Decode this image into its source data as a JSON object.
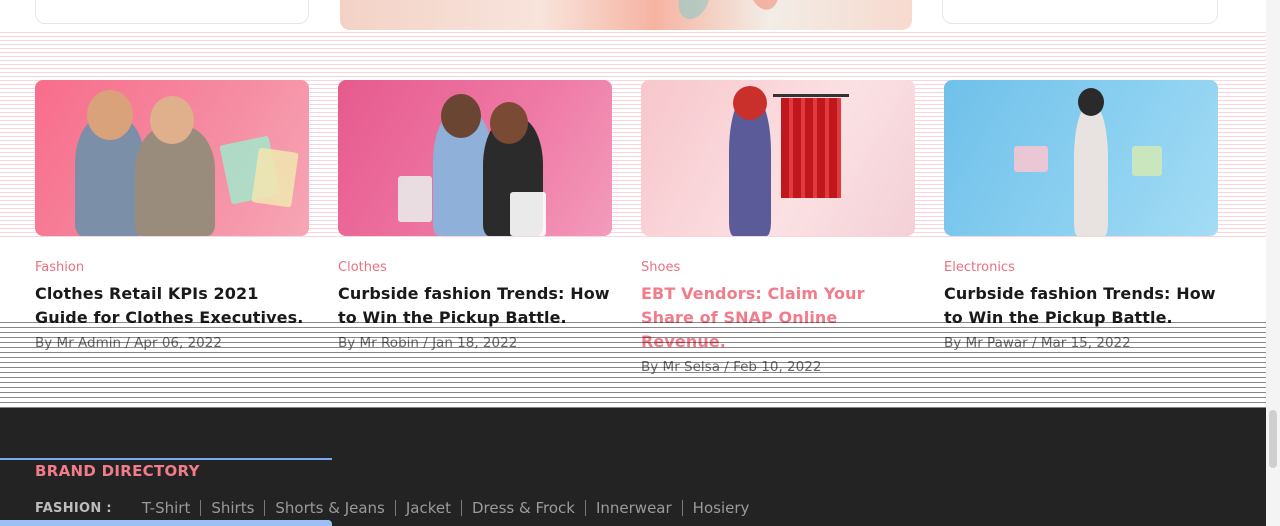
{
  "posts": [
    {
      "category": "Fashion",
      "title": "Clothes Retail KPIs 2021 Guide for Clothes Executives.",
      "meta": "By Mr Admin / Apr 06, 2022"
    },
    {
      "category": "Clothes",
      "title": "Curbside fashion Trends: How to Win the Pickup Battle.",
      "meta": "By Mr Robin / Jan 18, 2022"
    },
    {
      "category": "Shoes",
      "title": "EBT Vendors: Claim Your Share of SNAP Online Revenue.",
      "meta": "By Mr Selsa / Feb 10, 2022"
    },
    {
      "category": "Electronics",
      "title": "Curbside fashion Trends: How to Win the Pickup Battle.",
      "meta": "By Mr Pawar / Mar 15, 2022"
    }
  ],
  "footer": {
    "brand_directory": "BRAND DIRECTORY",
    "fashion_label": "FASHION :",
    "fashion_links": [
      "T-Shirt",
      "Shirts",
      "Shorts & Jeans",
      "Jacket",
      "Dress & Frock",
      "Innerwear",
      "Hosiery"
    ]
  },
  "colors": {
    "accent": "#f17c8a",
    "footer_bg": "#232323",
    "text": "#1a1a1a"
  }
}
